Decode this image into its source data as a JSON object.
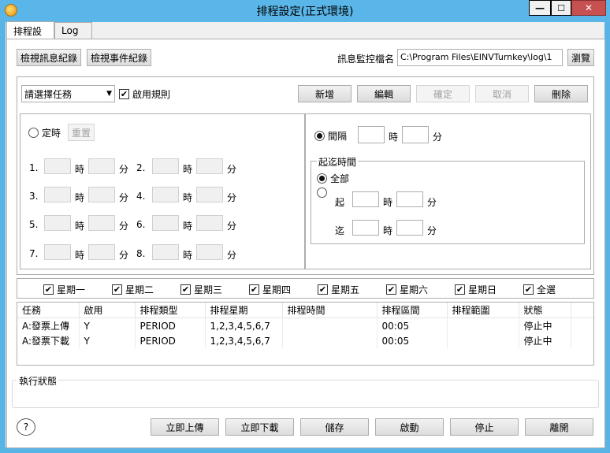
{
  "window": {
    "title": "排程設定(正式環境)",
    "minimize": "—",
    "maximize": "☐",
    "close": "✕"
  },
  "tabs": [
    {
      "label": "排程設定"
    },
    {
      "label": "Log"
    }
  ],
  "top": {
    "view_message_log": "檢視訊息紀錄",
    "view_event_log": "檢視事件紀錄",
    "monitor_label": "訊息監控檔名",
    "monitor_path": "C:\\Program Files\\EINVTurnkey\\log\\1",
    "browse": "瀏覽"
  },
  "rule": {
    "task_select": "請選擇任務",
    "enable_rule": "啟用規則",
    "add": "新增",
    "edit": "編輯",
    "confirm": "確定",
    "cancel": "取消",
    "delete": "刪除"
  },
  "fixed": {
    "label": "定時",
    "reset": "重置",
    "hour": "時",
    "minute": "分",
    "slots": [
      "1.",
      "2.",
      "3.",
      "4.",
      "5.",
      "6.",
      "7.",
      "8."
    ]
  },
  "interval": {
    "label": "間隔",
    "hour": "時",
    "minute": "分",
    "range_title": "起迄時間",
    "all": "全部",
    "start": "起",
    "end": "迄"
  },
  "days": [
    "星期一",
    "星期二",
    "星期三",
    "星期四",
    "星期五",
    "星期六",
    "星期日",
    "全選"
  ],
  "table": {
    "columns": [
      "任務",
      "啟用",
      "排程類型",
      "排程星期",
      "排程時間",
      "排程區間",
      "排程範圍",
      "狀態"
    ],
    "rows": [
      [
        "A:發票上傳",
        "Y",
        "PERIOD",
        "1,2,3,4,5,6,7",
        "",
        "00:05",
        "",
        "停止中"
      ],
      [
        "A:發票下載",
        "Y",
        "PERIOD",
        "1,2,3,4,5,6,7",
        "",
        "00:05",
        "",
        "停止中"
      ]
    ]
  },
  "status": {
    "label": "執行狀態"
  },
  "bottom": {
    "help": "?",
    "upload_now": "立即上傳",
    "download_now": "立即下載",
    "save": "儲存",
    "start": "啟動",
    "stop": "停止",
    "exit": "離開"
  },
  "colors": {
    "titlebar": "#5ab6e8",
    "close": "#c75050"
  }
}
